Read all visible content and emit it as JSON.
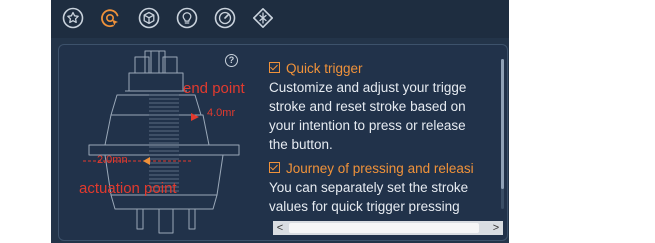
{
  "toolbar": {
    "icons": [
      "star-icon",
      "trigger-icon",
      "cube-icon",
      "bulb-icon",
      "gauge-icon",
      "diamond-icon"
    ],
    "active_index": 1,
    "active_color": "#f0923a",
    "icon_color": "#c9d2dc"
  },
  "diagram": {
    "help_label": "?",
    "end_point_label": "end point",
    "actuation_point_label": "actuation point",
    "end_distance": "4.0mr",
    "actuation_distance": "2.0mn",
    "label_color": "#e23a2e"
  },
  "info": {
    "sections": [
      {
        "title": "Quick trigger",
        "lines": [
          "Customize and adjust your trigge",
          "stroke and reset stroke based on",
          "your intention to press or release",
          "the button."
        ]
      },
      {
        "title": "Journey of pressing and releasi",
        "lines": [
          "You can separately set the stroke",
          "values for quick trigger pressing"
        ]
      }
    ]
  },
  "scrollbar": {
    "left_arrow": "<",
    "right_arrow": ">"
  }
}
